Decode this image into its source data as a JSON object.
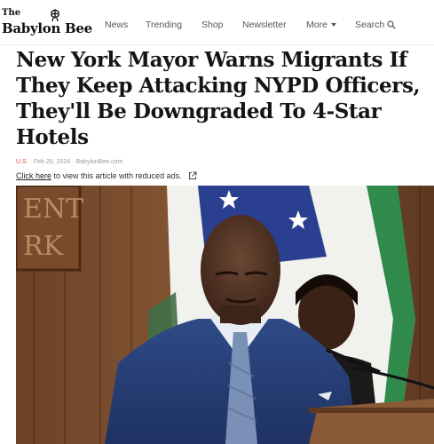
{
  "site": {
    "logo_small": "The",
    "logo_name": "Babylon Bee"
  },
  "nav": {
    "items": [
      {
        "label": "News"
      },
      {
        "label": "Trending"
      },
      {
        "label": "Shop"
      },
      {
        "label": "Newsletter"
      },
      {
        "label": "More"
      },
      {
        "label": "Search"
      }
    ]
  },
  "article": {
    "headline": "New York Mayor Warns Migrants If They Keep Attacking NYPD Officers, They'll Be Downgraded To 4-Star Hotels",
    "category": "U.S.",
    "date": "Feb 20, 2024",
    "source": "BabylonBee.com",
    "reduced_ads_link": "Click here",
    "reduced_ads_text": " to view this article with reduced ads."
  },
  "photo": {
    "wall_lettering": "ENT RK"
  },
  "colors": {
    "accent_category": "#d24b4b",
    "headline": "#151515",
    "nav_text": "#555555"
  }
}
